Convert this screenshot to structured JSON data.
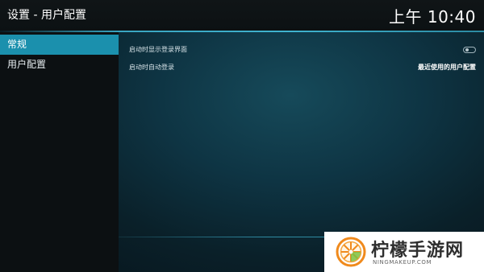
{
  "header": {
    "title": "设置 - 用户配置",
    "clock": "上午 10:40"
  },
  "sidebar": {
    "items": [
      {
        "label": "常规",
        "active": true
      },
      {
        "label": "用户配置",
        "active": false
      }
    ]
  },
  "settings": {
    "rows": [
      {
        "label": "启动时显示登录界面",
        "control": "toggle",
        "value": "off"
      },
      {
        "label": "启动时自动登录",
        "control": "value",
        "value": "最近使用的用户配置"
      }
    ]
  },
  "watermark": {
    "title": "柠檬手游网",
    "subtitle": "NINGMAKEUP.COM"
  },
  "colors": {
    "accent": "#1b90ad",
    "background": "#0e3443",
    "sidebar": "#0c1012",
    "watermark_orange": "#f08a1c",
    "watermark_green": "#7cc242"
  }
}
